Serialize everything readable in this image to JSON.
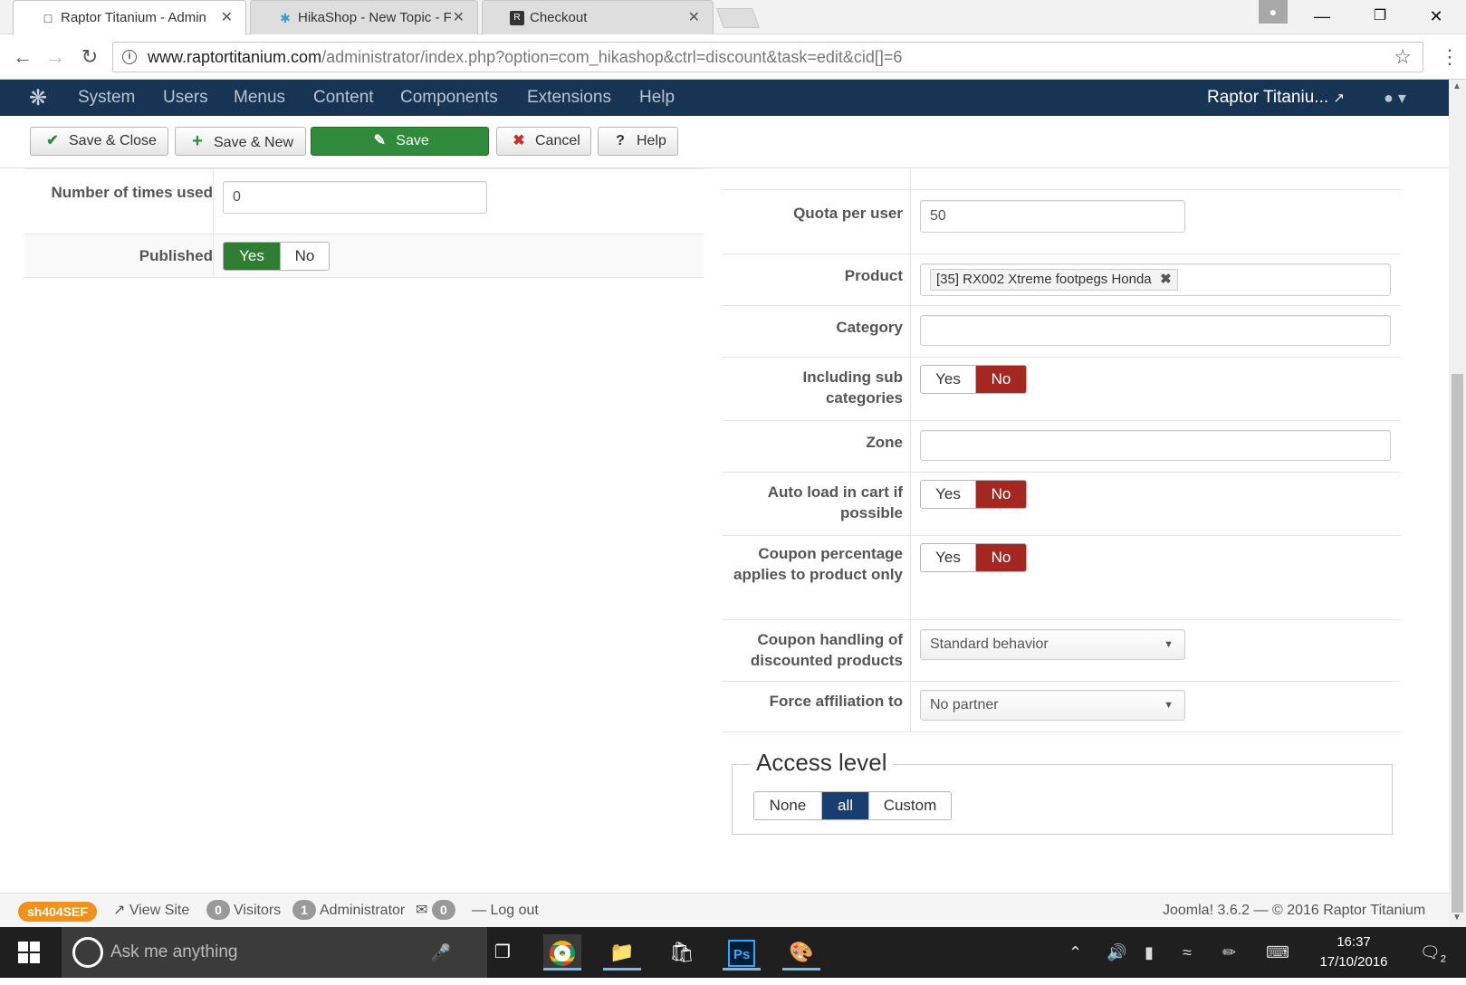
{
  "browser": {
    "tabs": [
      {
        "title": "Raptor Titanium - Admin",
        "active": true,
        "icon": "page-icon"
      },
      {
        "title": "HikaShop - New Topic - F",
        "active": false,
        "icon": "hikashop-icon"
      },
      {
        "title": "Checkout",
        "active": false,
        "icon": "raptor-logo-icon"
      }
    ],
    "url_host": "www.raptortitanium.com",
    "url_path": "/administrator/index.php?option=com_hikashop&ctrl=discount&task=edit&cid[]=6"
  },
  "joomla": {
    "menu": [
      "System",
      "Users",
      "Menus",
      "Content",
      "Components",
      "Extensions",
      "Help"
    ],
    "site_name": "Raptor Titaniu..."
  },
  "toolbar": {
    "save_close": "Save & Close",
    "save_new": "Save & New",
    "save": "Save",
    "cancel": "Cancel",
    "help": "Help"
  },
  "left": {
    "times_used_label": "Number of times used",
    "times_used_value": "0",
    "published_label": "Published",
    "published_yes": "Yes",
    "published_no": "No",
    "published_selected": "Yes"
  },
  "right": {
    "quota_label": "Quota per user",
    "quota_value": "50",
    "product_label": "Product",
    "product_tag": "[35] RX002 Xtreme footpegs Honda",
    "category_label": "Category",
    "subcat_label": "Including sub categories",
    "zone_label": "Zone",
    "autoload_label": "Auto load in cart if possible",
    "percentage_label": "Coupon percentage applies to product only",
    "handling_label": "Coupon handling of discounted products",
    "handling_value": "Standard behavior",
    "affiliation_label": "Force affiliation to",
    "affiliation_value": "No partner",
    "yes": "Yes",
    "no": "No"
  },
  "access": {
    "legend": "Access level",
    "none": "None",
    "all": "all",
    "custom": "Custom",
    "selected": "all"
  },
  "status": {
    "sh404": "sh404SEF",
    "view_site": "View Site",
    "visitors_count": "0",
    "visitors": "Visitors",
    "admin_count": "1",
    "admin": "Administrator",
    "messages_count": "0",
    "logout": "Log out",
    "version": "Joomla! 3.6.2",
    "copyright": "© 2016 Raptor Titanium"
  },
  "taskbar": {
    "search_placeholder": "Ask me anything",
    "time": "16:37",
    "date": "17/10/2016",
    "notifications": "2"
  },
  "colors": {
    "joomla_bar": "#173454",
    "save_green": "#2f8a3a",
    "no_red": "#a52721",
    "all_blue": "#173e6f",
    "sh404_orange": "#f0911c"
  }
}
